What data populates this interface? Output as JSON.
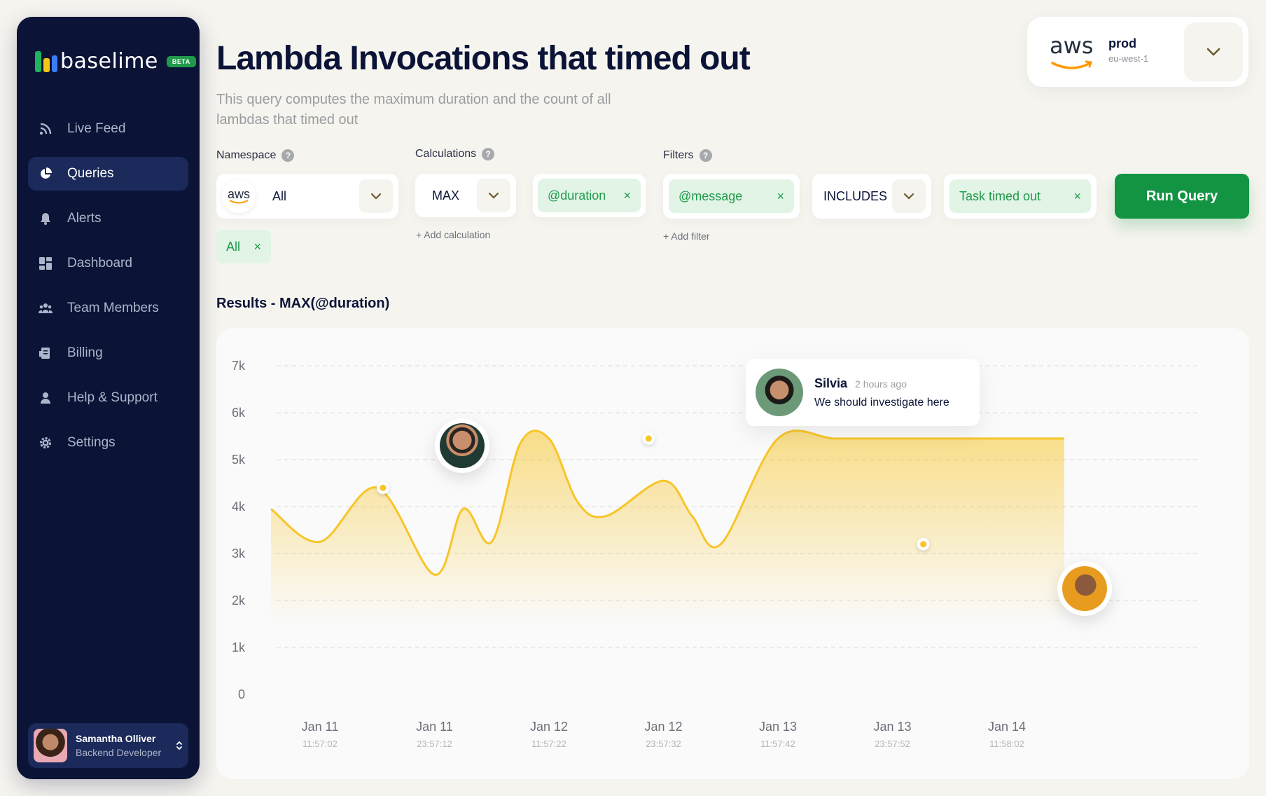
{
  "brand": {
    "name": "baselime",
    "badge": "BETA"
  },
  "sidebar": {
    "items": [
      {
        "label": "Live Feed",
        "icon": "rss-icon"
      },
      {
        "label": "Queries",
        "icon": "pie-chart-icon",
        "active": true
      },
      {
        "label": "Alerts",
        "icon": "bell-icon"
      },
      {
        "label": "Dashboard",
        "icon": "dashboard-grid-icon"
      },
      {
        "label": "Team Members",
        "icon": "team-icon"
      },
      {
        "label": "Billing",
        "icon": "receipt-icon"
      },
      {
        "label": "Help & Support",
        "icon": "person-icon"
      },
      {
        "label": "Settings",
        "icon": "gear-icon"
      }
    ],
    "user": {
      "name": "Samantha Olliver",
      "role": "Backend Developer"
    }
  },
  "header": {
    "title": "Lambda Invocations that timed out",
    "description": "This query computes the maximum duration and the count of all lambdas that timed out"
  },
  "environment": {
    "provider": "aws",
    "env": "prod",
    "region": "eu-west-1"
  },
  "query": {
    "namespace_label": "Namespace",
    "namespace_value": "All",
    "namespace_provider": "aws",
    "namespace_tag": "All",
    "calculations_label": "Calculations",
    "calc_operator": "MAX",
    "calc_field": "@duration",
    "add_calculation": "+ Add calculation",
    "filters_label": "Filters",
    "filter_field": "@message",
    "filter_operator": "INCLUDES",
    "filter_value": "Task timed out",
    "add_filter": "+ Add filter",
    "run_label": "Run Query",
    "help_glyph": "?",
    "remove_glyph": "×"
  },
  "results": {
    "title": "Results - MAX(@duration)"
  },
  "comment": {
    "author": "Silvia",
    "time": "2 hours ago",
    "text": "We should investigate here"
  },
  "colors": {
    "accent": "#139443",
    "sidebar": "#0b1437",
    "line": "#f7c52a",
    "tag_bg": "#e1f4e6"
  },
  "chart_data": {
    "type": "area",
    "y_ticks": [
      "7k",
      "6k",
      "5k",
      "4k",
      "3k",
      "2k",
      "1k",
      "0"
    ],
    "ylim": [
      0,
      7000
    ],
    "x_ticks": [
      {
        "date": "Jan 11",
        "time": "11:57:02"
      },
      {
        "date": "Jan 11",
        "time": "23:57:12"
      },
      {
        "date": "Jan 12",
        "time": "11:57:22"
      },
      {
        "date": "Jan 12",
        "time": "23:57:32"
      },
      {
        "date": "Jan 13",
        "time": "11:57:42"
      },
      {
        "date": "Jan 13",
        "time": "23:57:52"
      },
      {
        "date": "Jan 14",
        "time": "11:58:02"
      }
    ],
    "series": [
      {
        "x": [
          -0.5,
          0.0,
          0.5,
          1.0,
          1.25,
          1.5,
          1.75,
          2.0,
          2.25,
          2.5,
          3.0,
          3.25,
          3.5,
          4.0,
          4.5,
          5.0,
          5.5,
          6.0,
          6.5
        ],
        "values": [
          3950,
          3250,
          4400,
          2550,
          3950,
          3250,
          5350,
          5450,
          4100,
          3800,
          4550,
          3800,
          3200,
          5450,
          5450,
          5450,
          5450,
          5450,
          5450
        ]
      }
    ],
    "markers": [
      {
        "x": 0.55,
        "value": 4400
      },
      {
        "x": 2.87,
        "value": 5450
      },
      {
        "x": 5.27,
        "value": 3200
      }
    ],
    "grid": true
  }
}
